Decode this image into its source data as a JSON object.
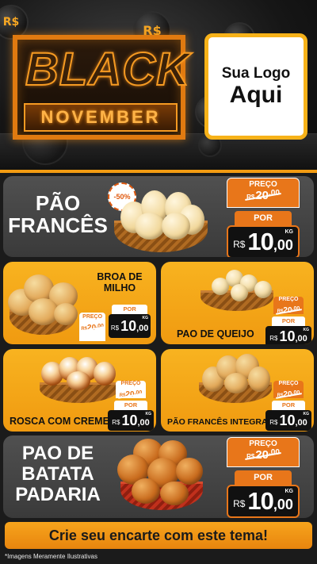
{
  "header": {
    "coin_symbol": "R$",
    "banner_top": "BLACK",
    "banner_bottom": "NOVEMBER",
    "logo_line1": "Sua Logo",
    "logo_line2": "Aqui"
  },
  "products": {
    "pao_frances": {
      "title_line1": "PÃO",
      "title_line2": "FRANCÊS",
      "discount": "-50%",
      "preco_label": "PREÇO",
      "old_currency": "R$",
      "old_main": "20",
      "old_cents": ",00",
      "por_label": "POR",
      "new_currency": "R$",
      "new_main": "10",
      "new_cents": ",00",
      "unit": "KG"
    },
    "broa_de_milho": {
      "title_line1": "BROA DE",
      "title_line2": "MILHO",
      "preco_label": "PREÇO",
      "old_currency": "R$",
      "old_main": "20",
      "old_cents": ",00",
      "por_label": "POR",
      "new_currency": "R$",
      "new_main": "10",
      "new_cents": ",00",
      "unit": "KG"
    },
    "pao_de_queijo": {
      "title": "PAO DE QUEIJO",
      "preco_label": "PREÇO",
      "old_currency": "R$",
      "old_main": "20",
      "old_cents": ",00",
      "por_label": "POR",
      "new_currency": "R$",
      "new_main": "10",
      "new_cents": ",00",
      "unit": "KG"
    },
    "rosca_com_creme": {
      "title": "ROSCA COM CREME",
      "preco_label": "PREÇO",
      "old_currency": "R$",
      "old_main": "20",
      "old_cents": ",00",
      "por_label": "POR",
      "new_currency": "R$",
      "new_main": "10",
      "new_cents": ",00",
      "unit": "KG"
    },
    "pao_frances_integral": {
      "title": "PÃO FRANCÊS INTEGRAL",
      "preco_label": "PREÇO",
      "old_currency": "R$",
      "old_main": "20",
      "old_cents": ",00",
      "por_label": "POR",
      "new_currency": "R$",
      "new_main": "10",
      "new_cents": ",00",
      "unit": "KG"
    },
    "pao_de_batata": {
      "title_line1": "PAO DE",
      "title_line2": "BATATA",
      "title_line3": "PADARIA",
      "preco_label": "PREÇO",
      "old_currency": "R$",
      "old_main": "20",
      "old_cents": ",00",
      "por_label": "POR",
      "new_currency": "R$",
      "new_main": "10",
      "new_cents": ",00",
      "unit": "KG"
    }
  },
  "footer": {
    "cta": "Crie seu encarte com este tema!",
    "disclaimer": "*Imagens Meramente Ilustrativas"
  },
  "colors": {
    "accent_orange": "#f39c12",
    "price_orange": "#e8761a",
    "dark_panel": "#444444",
    "background": "#1b1b1b"
  }
}
